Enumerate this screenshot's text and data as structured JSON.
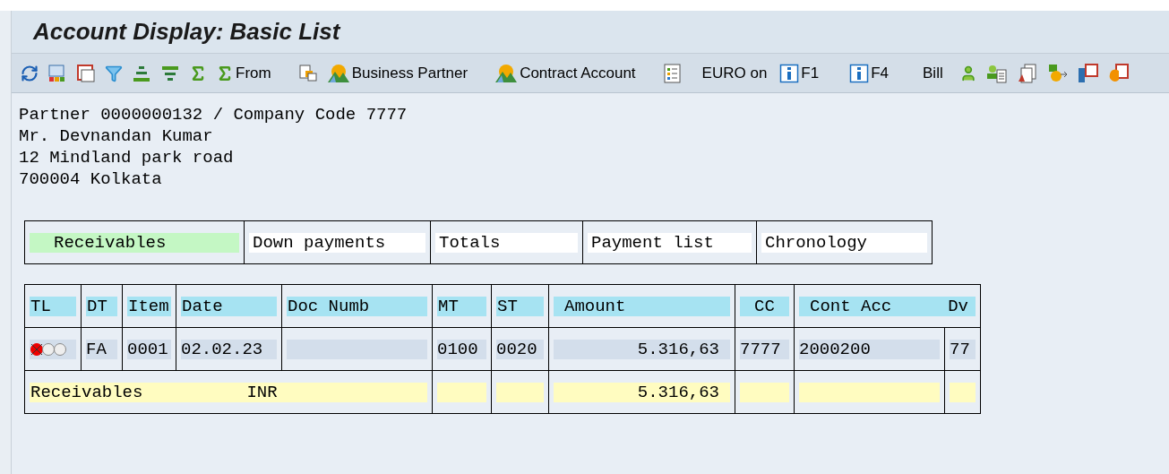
{
  "window": {
    "title": "Account Display: Basic List"
  },
  "toolbar": [
    "From",
    "Business Partner",
    "Contract Account",
    "EURO on",
    "F1",
    "F4",
    "Bill"
  ],
  "header_lines": [
    "Partner 0000000132 / Company Code 7777",
    "Mr. Devnandan Kumar",
    "12 Mindland park road",
    "700004 Kolkata"
  ],
  "tabs": [
    {
      "label": "Receivables",
      "selected": true
    },
    {
      "label": "Down payments",
      "selected": false
    },
    {
      "label": "Totals",
      "selected": false
    },
    {
      "label": "Payment list",
      "selected": false
    },
    {
      "label": "Chronology",
      "selected": false
    }
  ],
  "table": {
    "columns": [
      "TL",
      "DT",
      "Item",
      "Date",
      "Doc Numb",
      "MT",
      "ST",
      "Amount",
      "CC",
      "Cont Acc",
      "Dv"
    ],
    "rows": [
      {
        "color": "#ee0000",
        "cells": [
          "",
          "FA",
          "0001",
          "02.02.23",
          "",
          "0100",
          "0020",
          "5.316,63",
          "7777",
          "2000200",
          "77"
        ]
      }
    ],
    "total": {
      "label": "Receivables",
      "currency": "INR",
      "amount": "5.316,63"
    }
  }
}
